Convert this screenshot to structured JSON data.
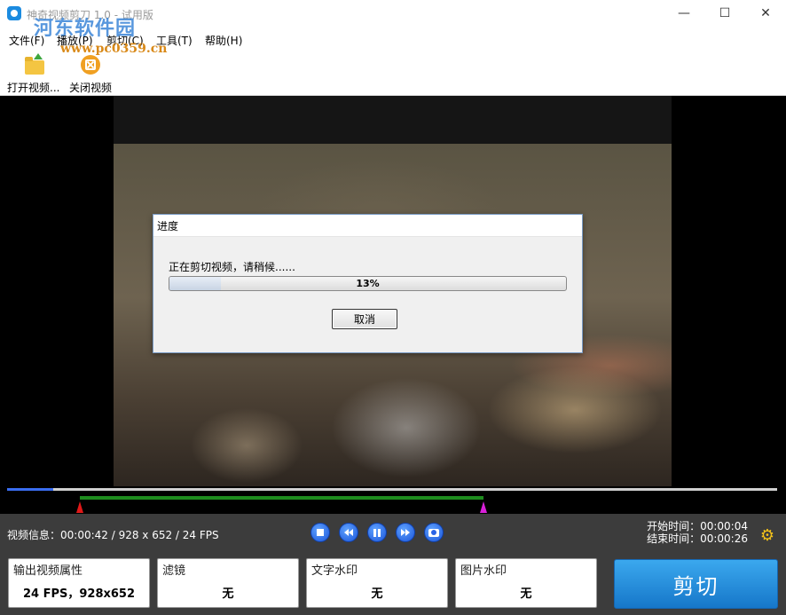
{
  "window": {
    "title": "神奇视频剪刀 1.0 - 试用版",
    "watermark": "河东软件园",
    "watermark_url": "www.pc0359.cn",
    "controls": {
      "minimize": "—",
      "maximize": "☐",
      "close": "✕"
    }
  },
  "menu": [
    {
      "label": "文件(F)"
    },
    {
      "label": "播放(P)"
    },
    {
      "label": "剪切(C)"
    },
    {
      "label": "工具(T)"
    },
    {
      "label": "帮助(H)"
    }
  ],
  "toolbar": {
    "open_video": "打开视频...",
    "close_video": "关闭视频"
  },
  "dialog": {
    "title": "进度",
    "message": "正在剪切视频，请稍候......",
    "progress_percent": 13,
    "progress_label": "13%",
    "cancel": "取消"
  },
  "timeline": {
    "playhead_fraction": 0.06,
    "range_start_fraction": 0.094,
    "range_end_fraction": 0.619
  },
  "controls": {
    "video_info": "视频信息：00:00:42 / 928 x 652 / 24 FPS",
    "start_time_label": "开始时间：",
    "start_time": "00:00:04",
    "end_time_label": "结束时间：",
    "end_time": "00:00:26"
  },
  "panels": [
    {
      "title": "输出视频属性",
      "value": "24 FPS，928x652"
    },
    {
      "title": "滤镜",
      "value": "无"
    },
    {
      "title": "文字水印",
      "value": "无"
    },
    {
      "title": "图片水印",
      "value": "无"
    }
  ],
  "cut_button": "剪切",
  "colors": {
    "accent_blue": "#1b8be0",
    "range_green": "#1e8c1e",
    "start_marker": "#e01818",
    "end_marker": "#d81fd8",
    "gear": "#f4c21a"
  }
}
